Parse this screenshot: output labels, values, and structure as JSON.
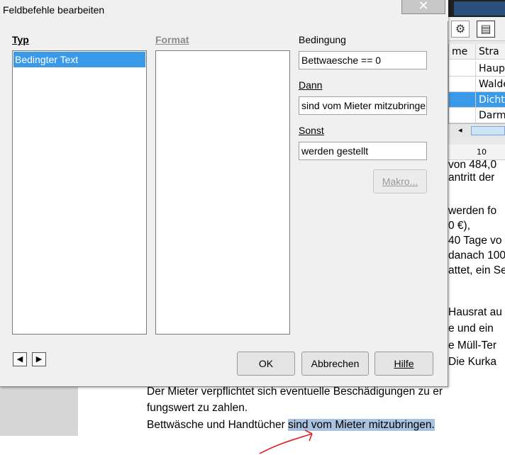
{
  "dialog": {
    "title": "Feldbefehle bearbeiten",
    "close_icon": "close-icon",
    "typ_label": "Typ",
    "typ_items": [
      "Bedingter Text"
    ],
    "format_label": "Format",
    "bedingung_label": "Bedingung",
    "bedingung_value": "Bettwaesche == 0",
    "dann_label": "Dann",
    "dann_value": "sind vom Mieter mitzubringen",
    "sonst_label": "Sonst",
    "sonst_value": "werden gestellt",
    "makro_label": "Makro...",
    "prev_icon": "arrow-left-icon",
    "next_icon": "arrow-right-icon",
    "ok_label": "OK",
    "abbrechen_label": "Abbrechen",
    "hilfe_label": "Hilfe",
    "accent": "#3b9ae8"
  },
  "background": {
    "grid_header": [
      "me",
      "Stra"
    ],
    "grid_rows": [
      [
        "",
        "Haupt"
      ],
      [
        "",
        "Walde"
      ],
      [
        "",
        "Dichtl"
      ],
      [
        "",
        "Darms"
      ]
    ],
    "ruler_mark": "10",
    "doc_lines_right": [
      "von 484,0",
      "antritt der",
      "werden fo",
      "0 €),",
      "40 Tage vo",
      "danach 100",
      "attet, ein Se",
      "Hausrat au",
      "e und ein",
      "e Müll-Ter",
      "Die Kurka"
    ],
    "doc_line_1": "Der Mieter verpflichtet sich eventuelle Beschädigungen zu er",
    "doc_line_2": "fungswert zu zahlen.",
    "doc_line_3_plain": "Bettwäsche und Handtücher ",
    "doc_line_3_selected": "sind vom Mieter mitzubringen.",
    "selection_color": "#a9c2e0",
    "annotation_color": "#e02020"
  }
}
